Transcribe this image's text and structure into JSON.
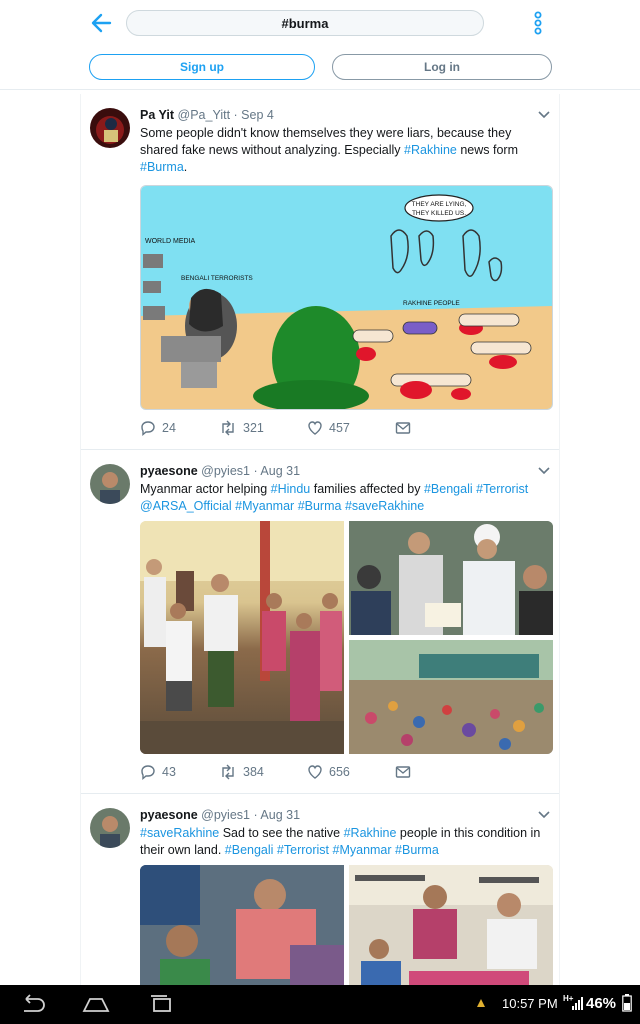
{
  "header": {
    "back_icon": "arrow-left-icon",
    "search_value": "#burma",
    "more_icon": "vertical-dots-icon"
  },
  "auth": {
    "signup_label": "Sign up",
    "login_label": "Log in"
  },
  "tweets": [
    {
      "name": "Pa Yit",
      "handle": "@Pa_Yitt",
      "date": "· Sep 4",
      "text_parts": [
        {
          "t": "Some people didn't know themselves they were liars, because they shared fake news without analyzing. Especially "
        },
        {
          "t": "#Rakhine",
          "tag": true
        },
        {
          "t": " news form "
        },
        {
          "t": "#Burma",
          "tag": true
        },
        {
          "t": "."
        }
      ],
      "cartoon": {
        "label_media": "WORLD MEDIA",
        "label_bengali": "BENGALI TERRORISTS",
        "label_rakhine": "RAKHINE PEOPLE",
        "bubble_line1": "THEY ARE LYING,",
        "bubble_line2": "THEY KILLED US."
      },
      "replies": "24",
      "retweets": "321",
      "likes": "457"
    },
    {
      "name": "pyaesone",
      "handle": "@pyies1",
      "date": "· Aug 31",
      "text_parts": [
        {
          "t": "Myanmar actor helping "
        },
        {
          "t": "#Hindu",
          "tag": true
        },
        {
          "t": " families affected by "
        },
        {
          "t": "#Bengali",
          "tag": true
        },
        {
          "t": " "
        },
        {
          "t": "#Terrorist",
          "tag": true
        },
        {
          "t": " "
        },
        {
          "t": "@ARSA_Official",
          "tag": true
        },
        {
          "t": " "
        },
        {
          "t": "#Myanmar",
          "tag": true
        },
        {
          "t": " "
        },
        {
          "t": "#Burma",
          "tag": true
        },
        {
          "t": " "
        },
        {
          "t": "#saveRakhine",
          "tag": true
        }
      ],
      "replies": "43",
      "retweets": "384",
      "likes": "656"
    },
    {
      "name": "pyaesone",
      "handle": "@pyies1",
      "date": "· Aug 31",
      "text_parts": [
        {
          "t": "#saveRakhine",
          "tag": true
        },
        {
          "t": " Sad to see the native "
        },
        {
          "t": "#Rakhine",
          "tag": true
        },
        {
          "t": " people in this condition in their own land. "
        },
        {
          "t": "#Bengali",
          "tag": true
        },
        {
          "t": " "
        },
        {
          "t": "#Terrorist",
          "tag": true
        },
        {
          "t": " "
        },
        {
          "t": "#Myanmar",
          "tag": true
        },
        {
          "t": " "
        },
        {
          "t": "#Burma",
          "tag": true
        }
      ]
    }
  ],
  "system": {
    "time": "10:57 PM",
    "network": "H+",
    "battery": "46%"
  },
  "colors": {
    "accent": "#1da1f2",
    "link": "#1b95e0",
    "muted": "#657786"
  }
}
